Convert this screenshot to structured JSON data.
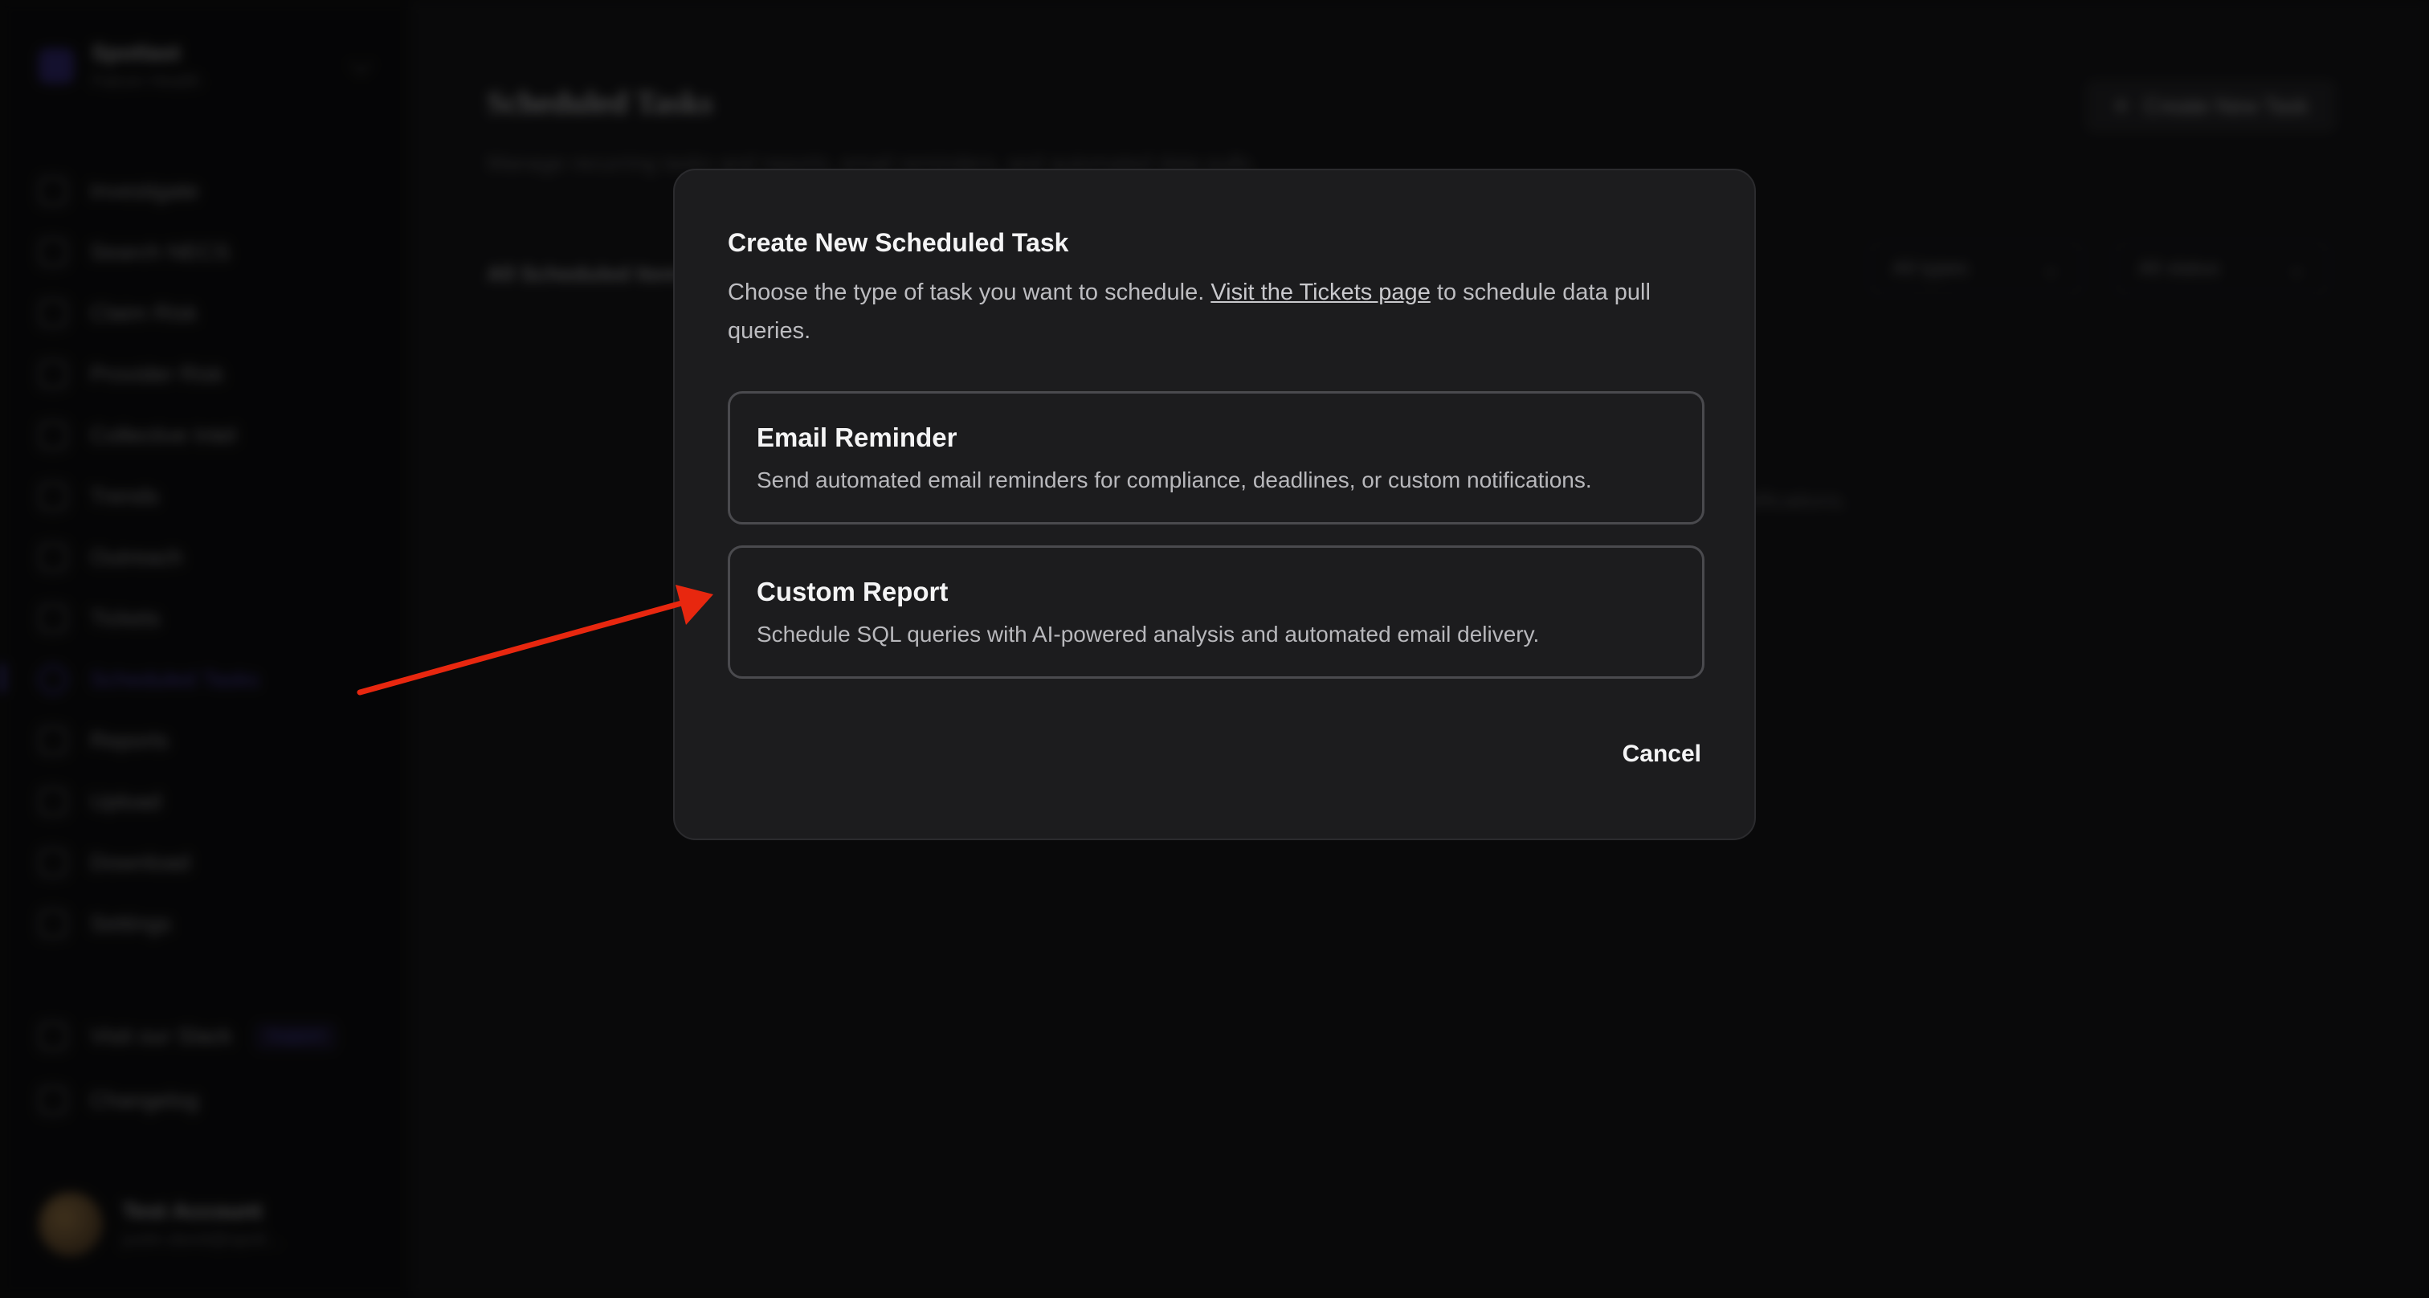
{
  "workspace": {
    "name": "Spotlast",
    "subtitle": "Falcon Health"
  },
  "sidebar": {
    "items": [
      {
        "label": "Investigate"
      },
      {
        "label": "Search NECS"
      },
      {
        "label": "Claim Risk"
      },
      {
        "label": "Provider Risk"
      },
      {
        "label": "Collective Intel"
      },
      {
        "label": "Trends"
      },
      {
        "label": "Outreach"
      },
      {
        "label": "Tickets"
      },
      {
        "label": "Scheduled Tasks"
      },
      {
        "label": "Reports"
      },
      {
        "label": "Upload"
      },
      {
        "label": "Download"
      },
      {
        "label": "Settings"
      }
    ],
    "slack": {
      "label": "Visit our Slack",
      "badge": "Support"
    },
    "changelog": "Changelog",
    "user": {
      "name": "Test Account",
      "email": "justin.david@spotl..."
    }
  },
  "page": {
    "title": "Scheduled Tasks",
    "subtitle": "Manage recurring tasks and reports, email reminders, and automated data pulls.",
    "create_button": "Create New Task",
    "filter_label": "All Scheduled Items",
    "filter_types": "All types",
    "filter_status": "All status",
    "empty_text": "notifications."
  },
  "dialog": {
    "title": "Create New Scheduled Task",
    "desc_before": "Choose the type of task you want to schedule. ",
    "desc_link": "Visit the Tickets page",
    "desc_after": " to schedule data pull queries.",
    "options": [
      {
        "title": "Email Reminder",
        "desc": "Send automated email reminders for compliance, deadlines, or custom notifications."
      },
      {
        "title": "Custom Report",
        "desc": "Schedule SQL queries with AI-powered analysis and automated email delivery."
      }
    ],
    "cancel": "Cancel"
  },
  "annotation": {
    "color": "#e8270f",
    "icon": "red-arrow-pointer"
  }
}
